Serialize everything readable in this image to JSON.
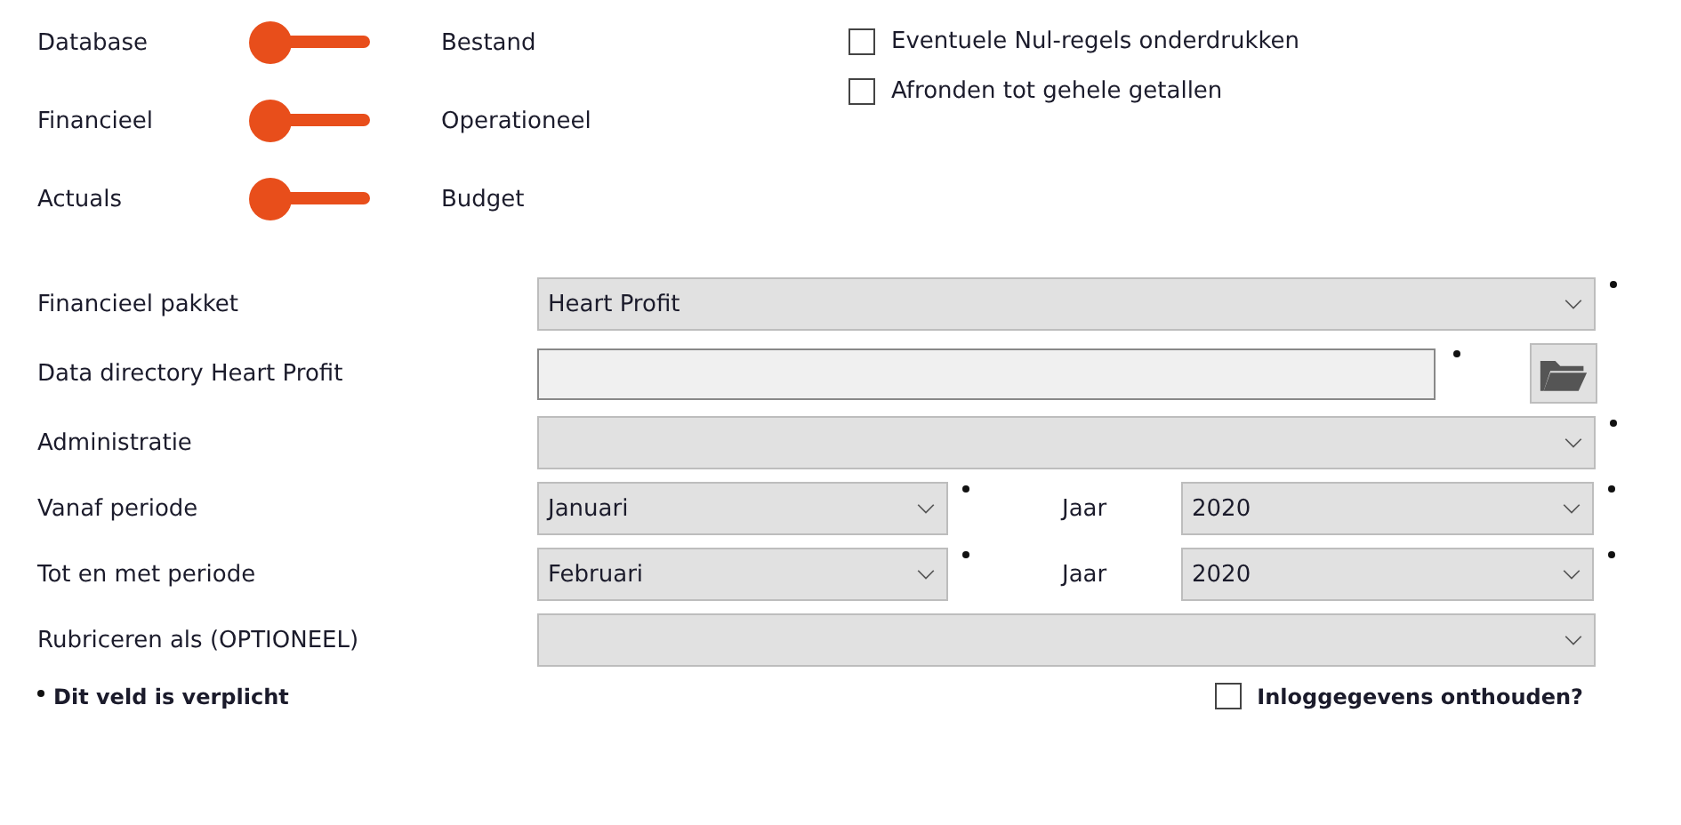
{
  "toggles": [
    {
      "left": "Database",
      "right": "Bestand",
      "on": false
    },
    {
      "left": "Financieel",
      "right": "Operationeel",
      "on": false
    },
    {
      "left": "Actuals",
      "right": "Budget",
      "on": false
    }
  ],
  "options": [
    {
      "label": "Eventuele Nul-regels onderdrukken",
      "checked": false
    },
    {
      "label": "Afronden tot gehele getallen",
      "checked": false
    }
  ],
  "form": [
    {
      "kind": "select",
      "label": "Financieel pakket",
      "value": "Heart Profit",
      "required": true
    },
    {
      "kind": "folder",
      "label": "Data directory Heart Profit",
      "required": true
    },
    {
      "kind": "select",
      "label": "Administratie",
      "required": true
    },
    {
      "kind": "period",
      "label": "Vanaf periode",
      "value": "Januari",
      "required": true,
      "year_label": "Jaar",
      "year": "2020",
      "year_required": true
    },
    {
      "kind": "period",
      "label": "Tot en met periode",
      "value": "Februari",
      "required": true,
      "year_label": "Jaar",
      "year": "2020",
      "year_required": true
    },
    {
      "kind": "select",
      "label": "Rubriceren als (OPTIONEEL)",
      "required": false
    }
  ],
  "footnote": "Dit veld is verplicht",
  "remember": {
    "label": "Inloggegevens onthouden?",
    "checked": false
  }
}
